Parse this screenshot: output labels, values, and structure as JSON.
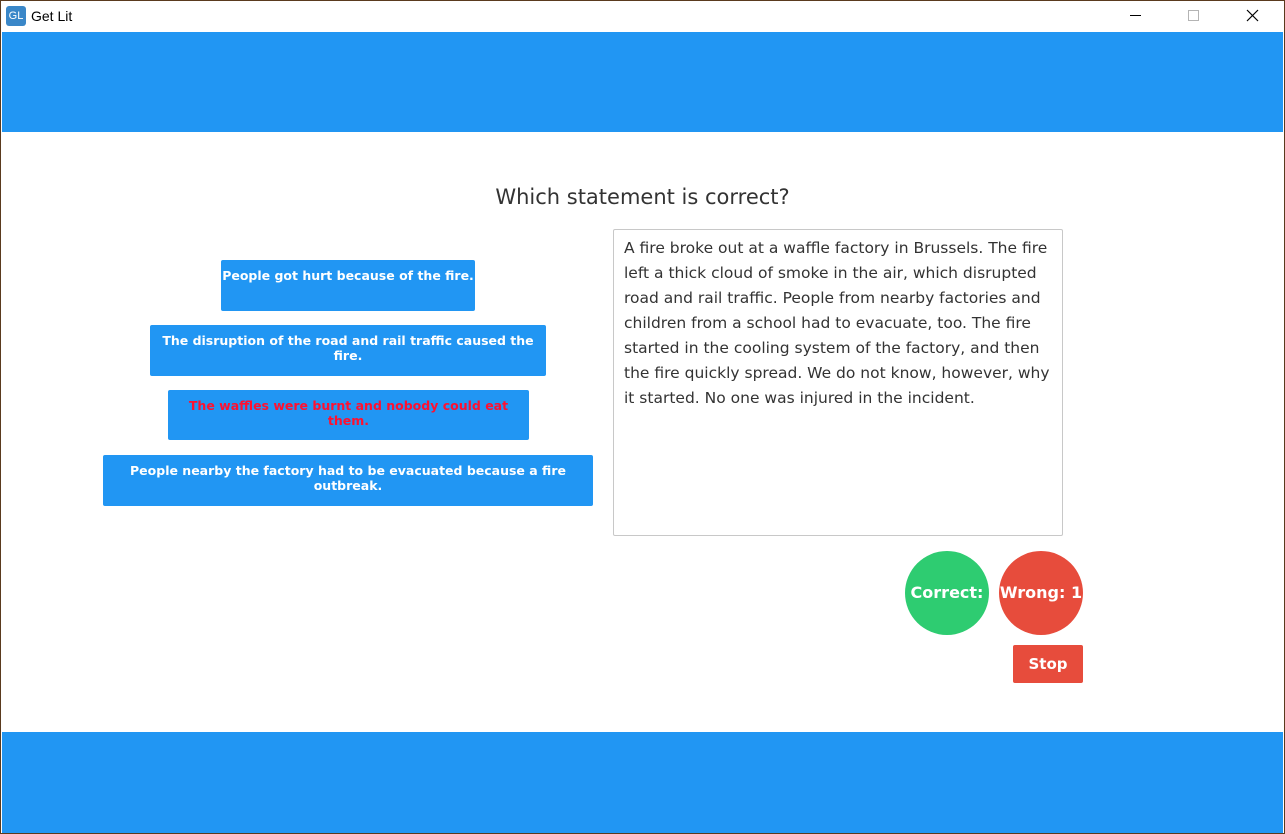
{
  "window": {
    "title": "Get Lit",
    "icon_text": "GL",
    "controls": [
      "minimize-icon",
      "maximize-icon",
      "close-icon"
    ]
  },
  "colors": {
    "band": "#2196f3",
    "answer_bg": "#2196f3",
    "correct": "#2ecc71",
    "wrong": "#e74c3c",
    "stop": "#e74c3c",
    "wrong_answer_text": "#ff1030"
  },
  "quiz": {
    "question": "Which statement is correct?",
    "answers": [
      {
        "label": "People got hurt because of the fire."
      },
      {
        "label": "The disruption of the road and rail traffic caused the fire."
      },
      {
        "label": "The waffles were burnt and nobody could eat them.",
        "marked_wrong": true
      },
      {
        "label": "People nearby the factory had to be evacuated because a fire outbreak."
      }
    ],
    "passage": "A fire broke out at a waffle factory in Brussels. The fire left a thick cloud of smoke in the air, which disrupted road and rail traffic. People from nearby factories and children from a school had to evacuate, too. The fire started in the cooling system of the factory, and then the fire quickly spread. We do not know, however, why it started. No one was injured in the incident."
  },
  "score": {
    "correct_label": "Correct:",
    "wrong_label": "Wrong: 1"
  },
  "controls": {
    "stop_label": "Stop"
  }
}
